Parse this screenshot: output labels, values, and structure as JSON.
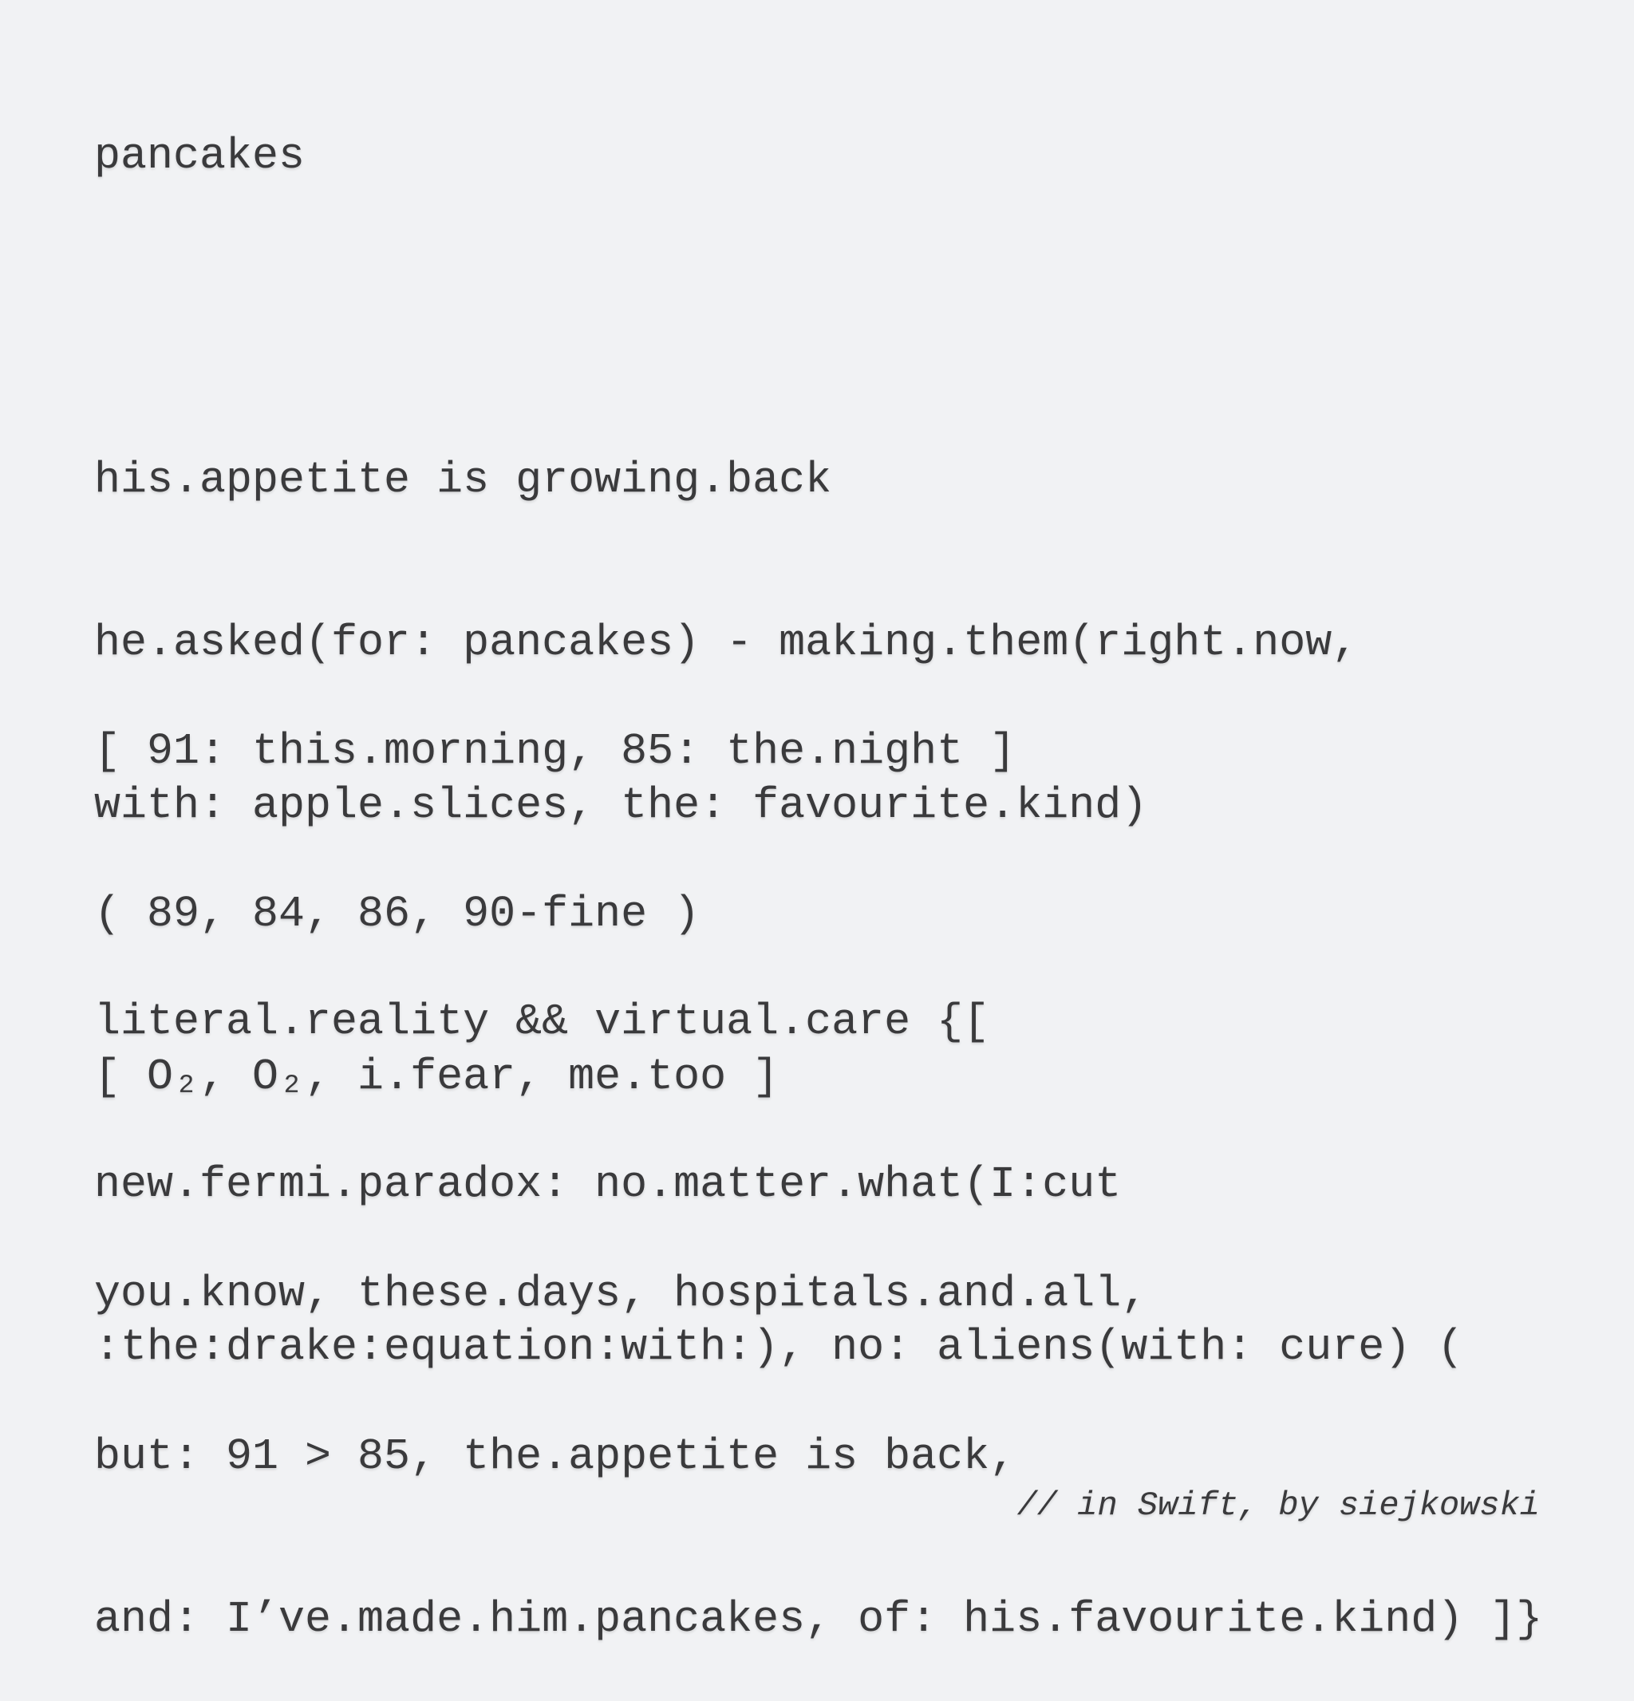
{
  "title": "pancakes",
  "stanzas": [
    [
      "his.appetite is growing.back",
      "he.asked(for: pancakes) - making.them(right.now,",
      "with: apple.slices, the: favourite.kind)"
    ],
    [
      "[ 91: this.morning, 85: the.night ]",
      "( 89, 84, 86, 90-fine )",
      "[ O₂, O₂, i.fear, me.too ]"
    ],
    [
      "literal.reality && virtual.care {[",
      "new.fermi.paradox: no.matter.what(I:cut",
      ":the:drake:equation:with:), no: aliens(with: cure) ("
    ],
    [
      "you.know, these.days, hospitals.and.all,",
      "but: 91 > 85, the.appetite is back,",
      "and: I’ve.made.him.pancakes, of: his.favourite.kind) ]}"
    ]
  ],
  "footer": "// in Swift, by siejkowski",
  "colors": {
    "background": "#f1f2f4",
    "text": "#3a3a3c"
  }
}
